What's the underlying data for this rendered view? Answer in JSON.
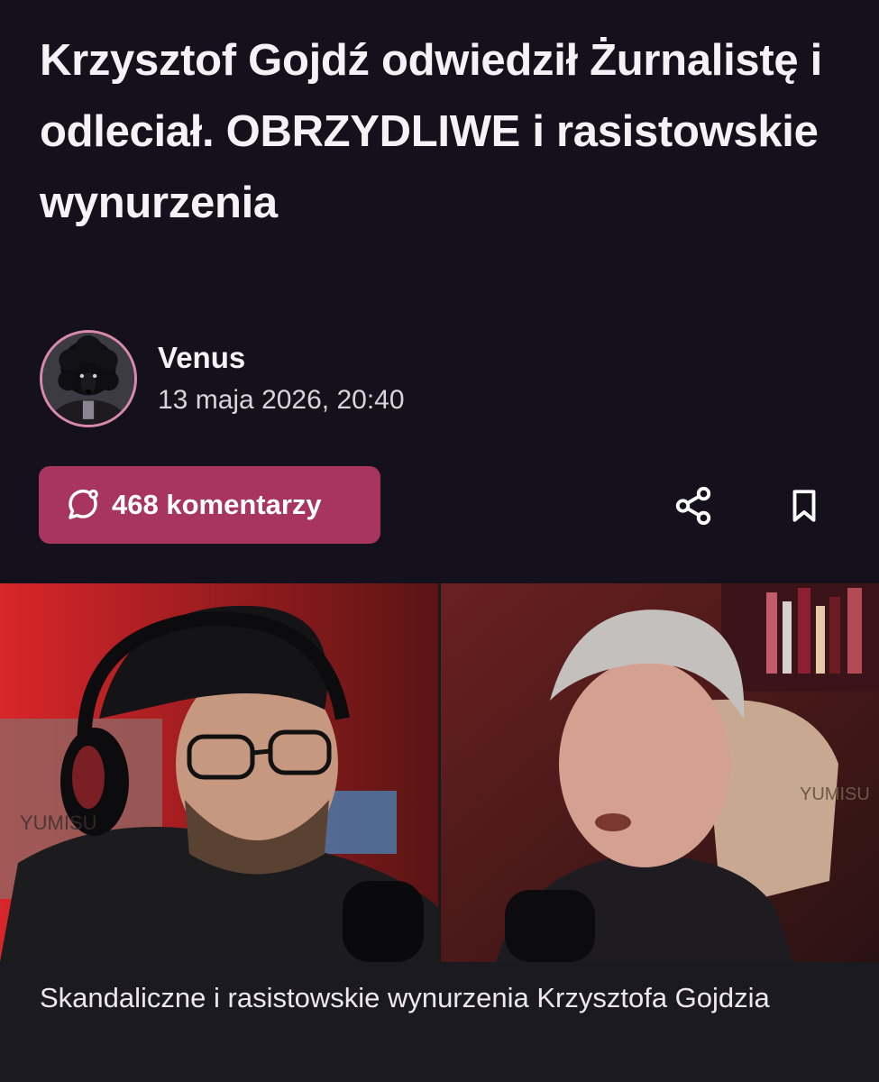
{
  "article": {
    "title": "Krzysztof Gojdź odwiedził Żurnalistę i odleciał. OBRZYDLIWE i rasistowskie wynurzenia",
    "author": {
      "name": "Venus",
      "date": "13 maja 2026, 20:40",
      "avatar_icon": "poodle-avatar"
    },
    "actions": {
      "comments_label": "468 komentarzy",
      "comments_icon": "chat-bubble-icon",
      "share_icon": "share-icon",
      "bookmark_icon": "bookmark-icon"
    },
    "image": {
      "caption": "Skandaliczne i rasistowskie wynurzenia Krzysztofa Gojdzia"
    }
  },
  "colors": {
    "background": "#15111c",
    "accent": "#a8355f",
    "avatar_ring": "#d98aab",
    "caption_background": "#1c1a21"
  }
}
